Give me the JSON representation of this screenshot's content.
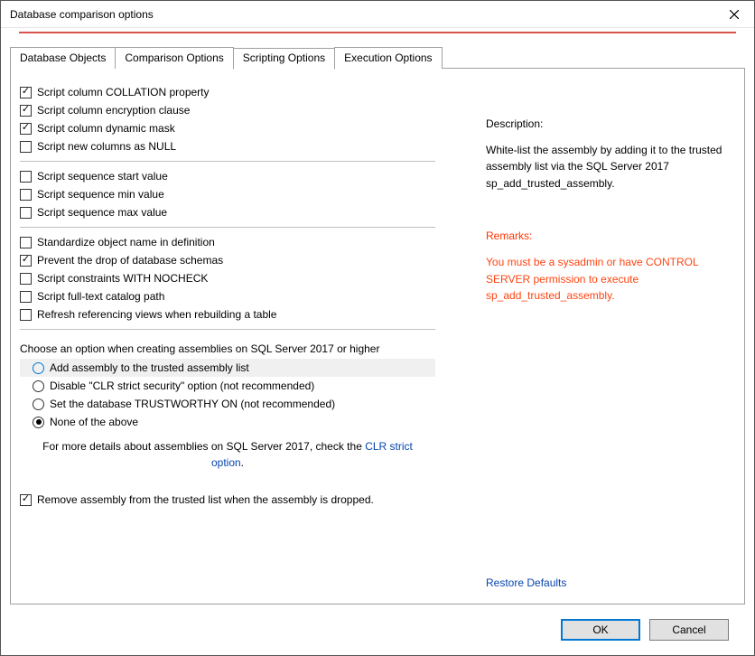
{
  "window": {
    "title": "Database comparison options"
  },
  "tabs": {
    "items": [
      {
        "label": "Database Objects",
        "active": false
      },
      {
        "label": "Comparison Options",
        "active": false
      },
      {
        "label": "Scripting Options",
        "active": true
      },
      {
        "label": "Execution Options",
        "active": false
      }
    ]
  },
  "options": {
    "group1": [
      {
        "label": "Script column COLLATION property",
        "checked": true
      },
      {
        "label": "Script column encryption clause",
        "checked": true
      },
      {
        "label": "Script column dynamic mask",
        "checked": true
      },
      {
        "label": "Script new columns as NULL",
        "checked": false
      }
    ],
    "group2": [
      {
        "label": "Script sequence start value",
        "checked": false
      },
      {
        "label": "Script sequence min value",
        "checked": false
      },
      {
        "label": "Script sequence max value",
        "checked": false
      }
    ],
    "group3": [
      {
        "label": "Standardize object name in definition",
        "checked": false
      },
      {
        "label": "Prevent the drop of database schemas",
        "checked": true
      },
      {
        "label": "Script constraints WITH NOCHECK",
        "checked": false
      },
      {
        "label": "Script full-text catalog path",
        "checked": false
      },
      {
        "label": "Refresh referencing views when rebuilding a table",
        "checked": false
      }
    ],
    "assembly_heading": "Choose an option when creating assemblies on SQL Server 2017 or higher",
    "assembly_radios": [
      {
        "label": "Add assembly to the trusted assembly list",
        "selected": false,
        "highlight": true
      },
      {
        "label": "Disable \"CLR strict security\" option (not recommended)",
        "selected": false
      },
      {
        "label": "Set the database TRUSTWORTHY ON (not recommended)",
        "selected": false
      },
      {
        "label": "None of the above",
        "selected": true
      }
    ],
    "fineprint_prefix": "For more details about assemblies on SQL Server 2017, check the ",
    "fineprint_link": "CLR strict option",
    "fineprint_suffix": ".",
    "remove_assembly": {
      "label": "Remove assembly from the trusted list when the assembly is dropped.",
      "checked": true
    }
  },
  "description": {
    "title": "Description:",
    "body": "White-list the assembly by adding it to the trusted assembly list via the SQL Server 2017 sp_add_trusted_assembly.",
    "remarks_title": "Remarks:",
    "remarks_body": "You must be a sysadmin or have CONTROL SERVER permission to execute sp_add_trusted_assembly."
  },
  "footer": {
    "restore": "Restore Defaults",
    "ok": "OK",
    "cancel": "Cancel"
  }
}
